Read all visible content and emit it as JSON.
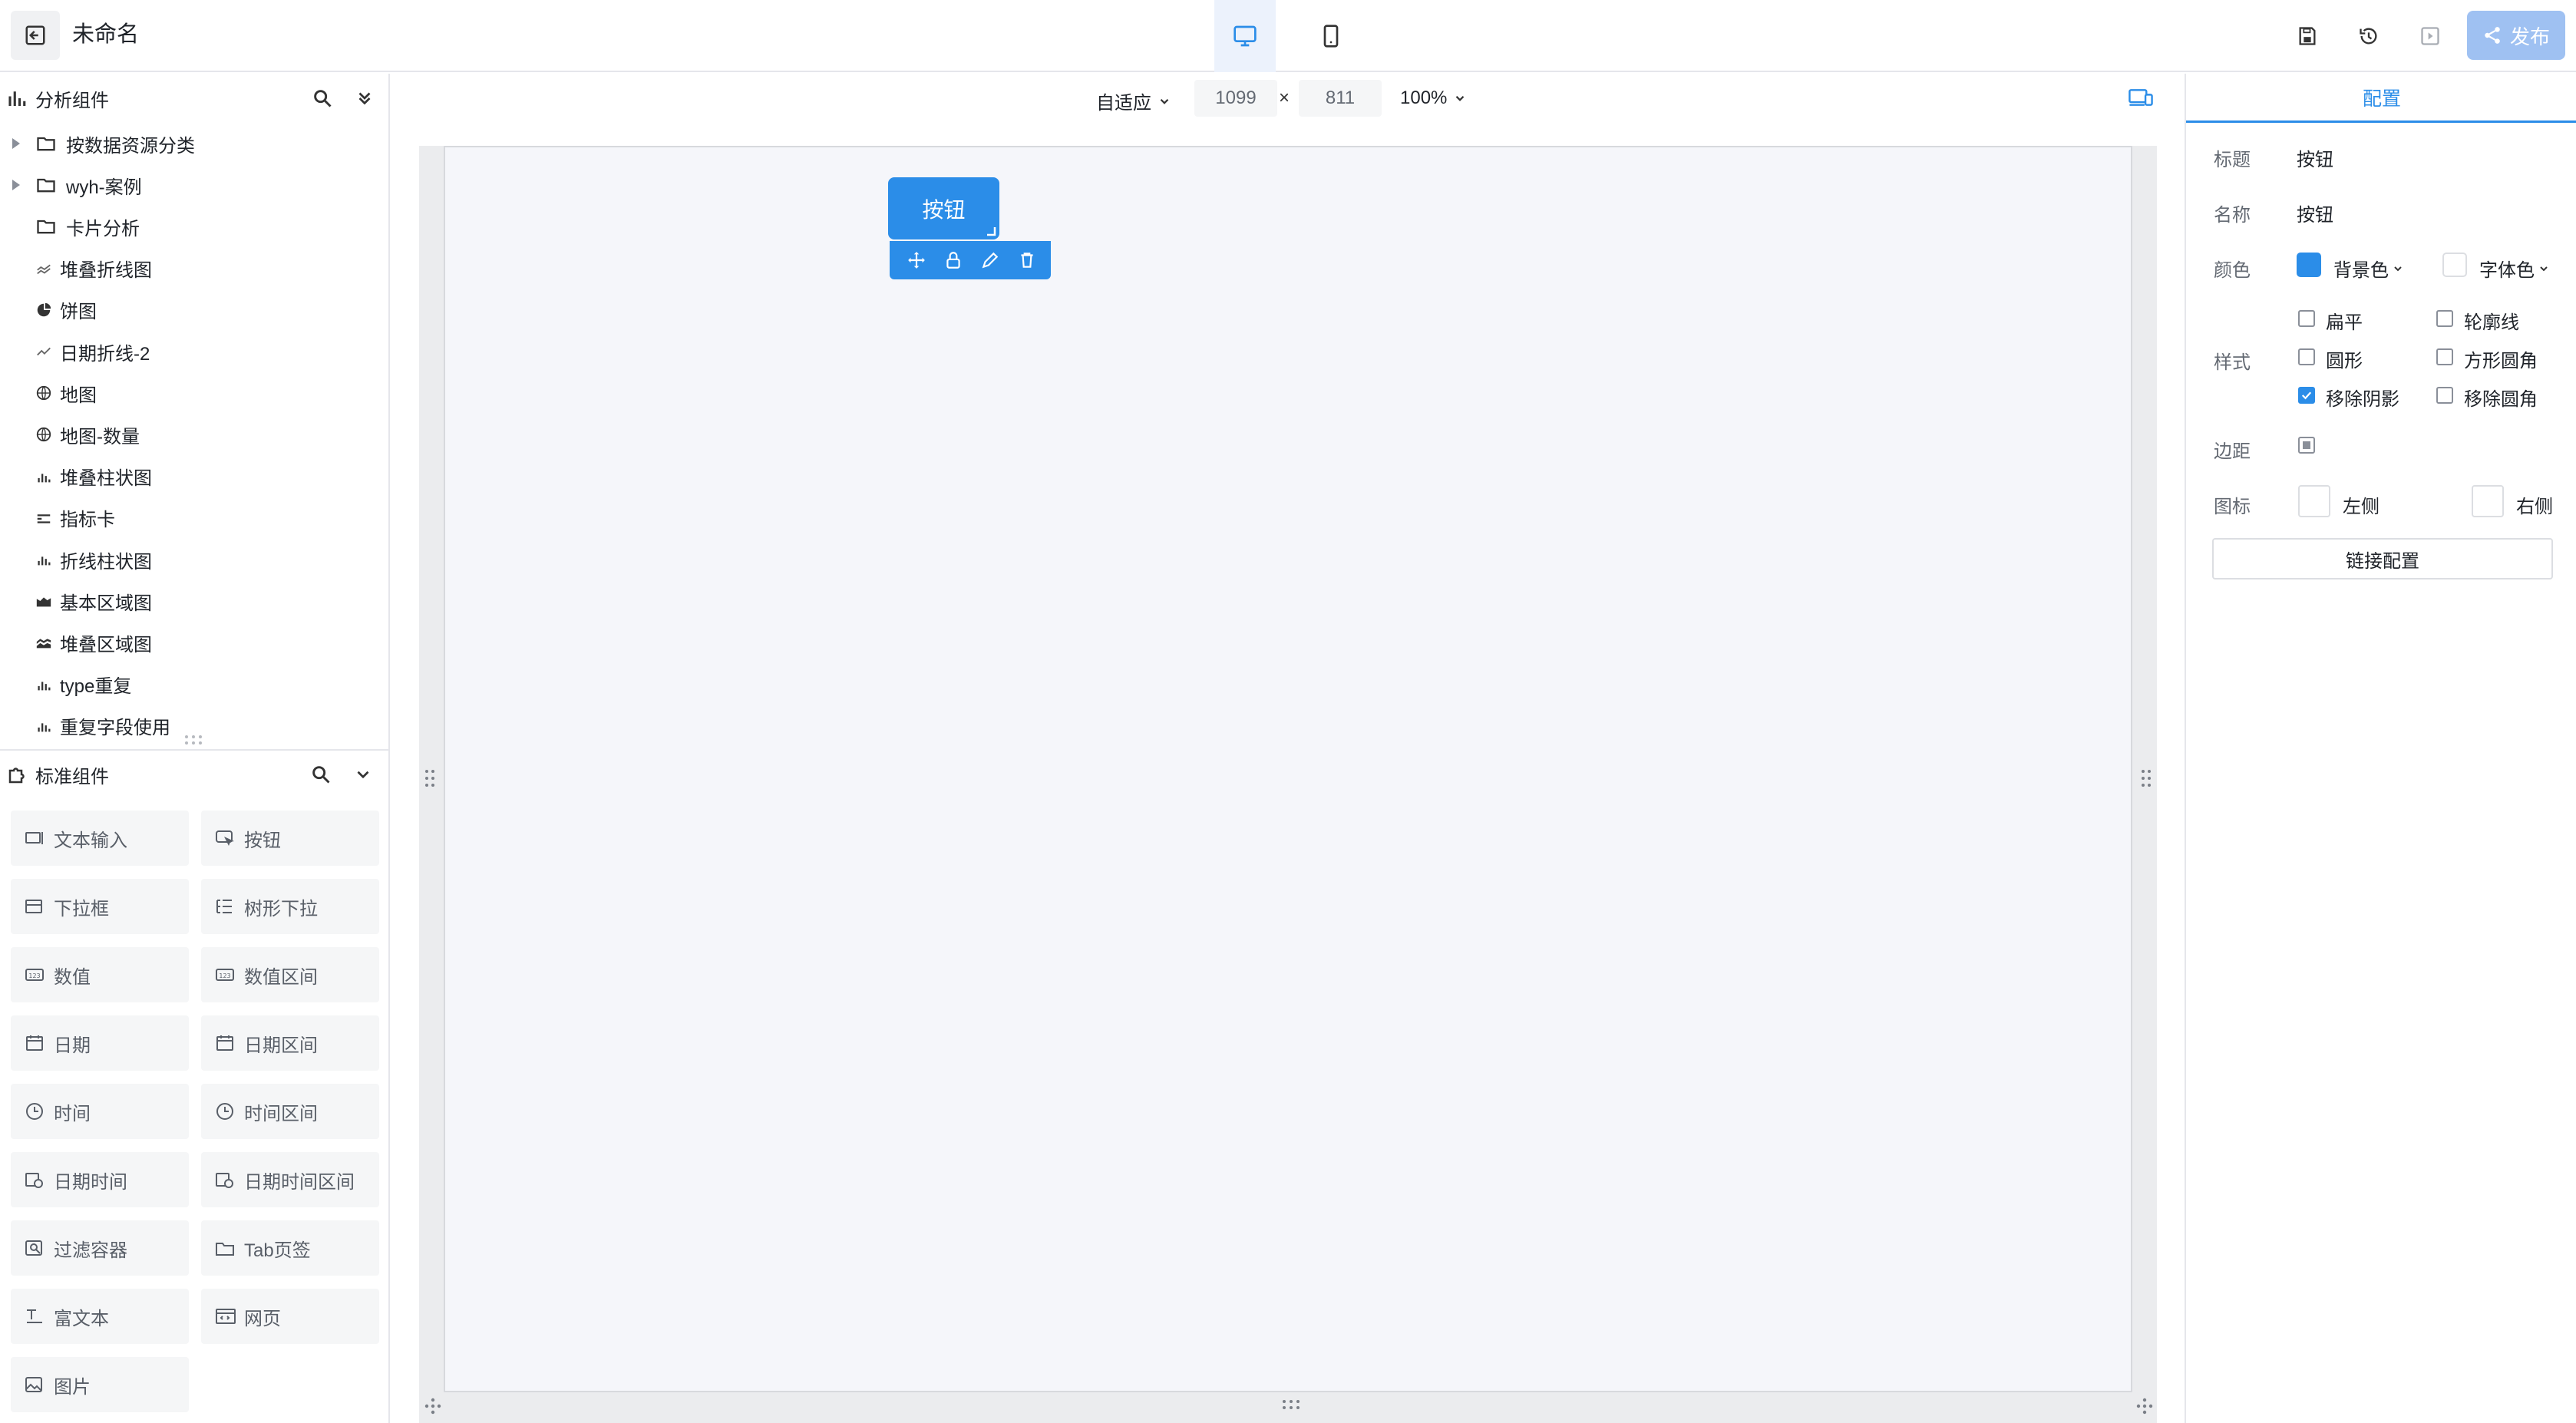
{
  "header": {
    "title": "未命名",
    "publish_label": "发布"
  },
  "analysis_section": {
    "title": "分析组件",
    "items": [
      {
        "label": "按数据资源分类",
        "icon": "folder-icon",
        "expandable": true
      },
      {
        "label": "wyh-案例",
        "icon": "folder-icon",
        "expandable": true
      },
      {
        "label": "卡片分析",
        "icon": "folder-icon",
        "expandable": false
      },
      {
        "label": "堆叠折线图",
        "icon": "stacked-line-chart-icon"
      },
      {
        "label": "饼图",
        "icon": "pie-chart-icon"
      },
      {
        "label": "日期折线-2",
        "icon": "line-chart-icon"
      },
      {
        "label": "地图",
        "icon": "globe-icon"
      },
      {
        "label": "地图-数量",
        "icon": "globe-icon"
      },
      {
        "label": "堆叠柱状图",
        "icon": "bar-chart-icon"
      },
      {
        "label": "指标卡",
        "icon": "metric-card-icon"
      },
      {
        "label": "折线柱状图",
        "icon": "bar-chart-icon"
      },
      {
        "label": "基本区域图",
        "icon": "area-chart-icon"
      },
      {
        "label": "堆叠区域图",
        "icon": "stacked-area-chart-icon"
      },
      {
        "label": "type重复",
        "icon": "bar-chart-icon"
      },
      {
        "label": "重复字段使用",
        "icon": "bar-chart-icon"
      }
    ]
  },
  "standard_section": {
    "title": "标准组件",
    "items": [
      {
        "label": "文本输入",
        "icon": "text-input-icon"
      },
      {
        "label": "按钮",
        "icon": "button-icon"
      },
      {
        "label": "下拉框",
        "icon": "dropdown-icon"
      },
      {
        "label": "树形下拉",
        "icon": "tree-select-icon"
      },
      {
        "label": "数值",
        "icon": "number-icon"
      },
      {
        "label": "数值区间",
        "icon": "number-range-icon"
      },
      {
        "label": "日期",
        "icon": "calendar-icon"
      },
      {
        "label": "日期区间",
        "icon": "calendar-range-icon"
      },
      {
        "label": "时间",
        "icon": "clock-icon"
      },
      {
        "label": "时间区间",
        "icon": "clock-range-icon"
      },
      {
        "label": "日期时间",
        "icon": "datetime-icon"
      },
      {
        "label": "日期时间区间",
        "icon": "datetime-range-icon"
      },
      {
        "label": "过滤容器",
        "icon": "filter-container-icon"
      },
      {
        "label": "Tab页签",
        "icon": "tab-icon"
      },
      {
        "label": "富文本",
        "icon": "rich-text-icon"
      },
      {
        "label": "网页",
        "icon": "webpage-icon"
      },
      {
        "label": "图片",
        "icon": "image-icon"
      }
    ]
  },
  "toolbar": {
    "fit_mode": "自适应",
    "width": "1099",
    "times": "×",
    "height": "811",
    "zoom": "100%"
  },
  "canvas": {
    "button_widget_label": "按钮"
  },
  "config_panel": {
    "tab": "配置",
    "title_label": "标题",
    "title_value": "按钮",
    "name_label": "名称",
    "name_value": "按钮",
    "color_label": "颜色",
    "bg_color_label": "背景色",
    "bg_color": "#2b8de8",
    "font_color_label": "字体色",
    "font_color": "#ffffff",
    "style_label": "样式",
    "styles": [
      {
        "label": "扁平",
        "checked": false
      },
      {
        "label": "轮廓线",
        "checked": false
      },
      {
        "label": "圆形",
        "checked": false
      },
      {
        "label": "方形圆角",
        "checked": false
      },
      {
        "label": "移除阴影",
        "checked": true
      },
      {
        "label": "移除圆角",
        "checked": false
      }
    ],
    "margin_label": "边距",
    "icon_label": "图标",
    "icon_left_label": "左侧",
    "icon_right_label": "右侧",
    "link_config_label": "链接配置"
  },
  "colors": {
    "accent": "#2b8de8",
    "publish_disabled": "#9fc1f2"
  }
}
